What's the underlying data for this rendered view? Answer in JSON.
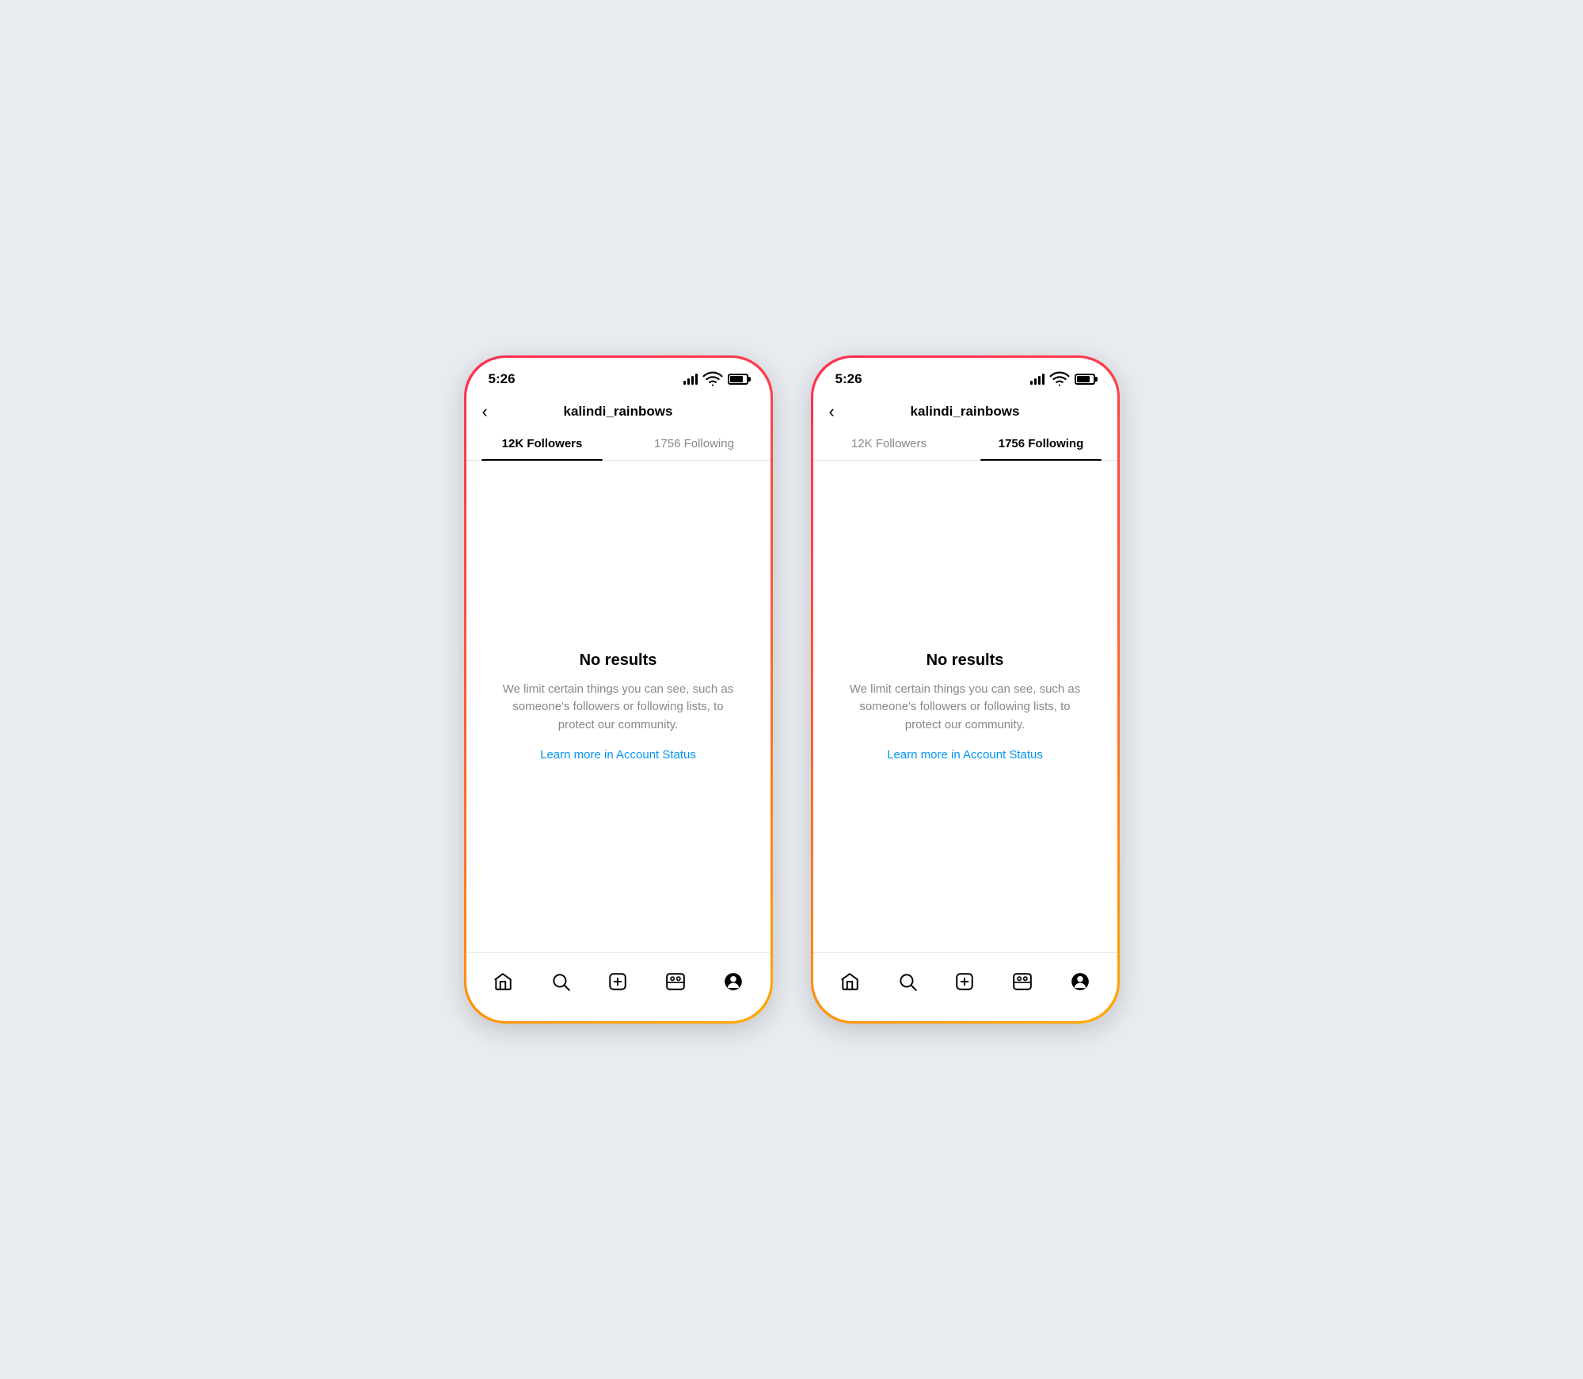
{
  "page": {
    "background": "#e8ecf0"
  },
  "phones": [
    {
      "id": "phone-left",
      "status_bar": {
        "time": "5:26"
      },
      "nav": {
        "back_label": "‹",
        "title": "kalindi_rainbows"
      },
      "tabs": [
        {
          "label": "12K Followers",
          "active": true
        },
        {
          "label": "1756 Following",
          "active": false
        }
      ],
      "content": {
        "no_results_title": "No results",
        "no_results_desc": "We limit certain things you can see, such as someone's followers or following lists, to protect our community.",
        "learn_more_label": "Learn more in Account Status"
      }
    },
    {
      "id": "phone-right",
      "status_bar": {
        "time": "5:26"
      },
      "nav": {
        "back_label": "‹",
        "title": "kalindi_rainbows"
      },
      "tabs": [
        {
          "label": "12K Followers",
          "active": false
        },
        {
          "label": "1756 Following",
          "active": true
        }
      ],
      "content": {
        "no_results_title": "No results",
        "no_results_desc": "We limit certain things you can see, such as someone's followers or following lists, to protect our community.",
        "learn_more_label": "Learn more in Account Status"
      }
    }
  ]
}
